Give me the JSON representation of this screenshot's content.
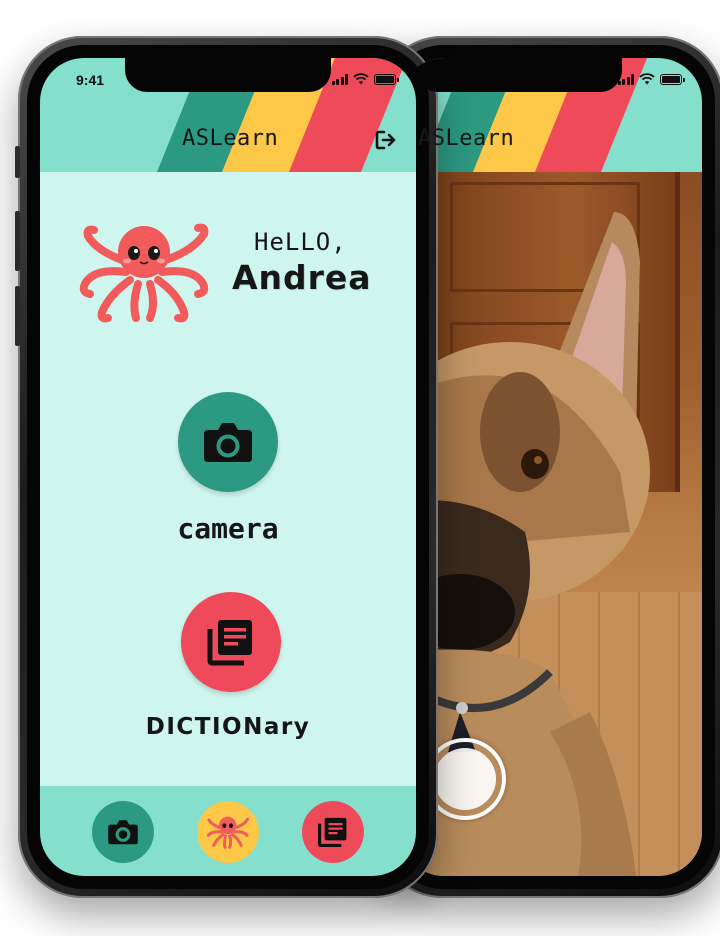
{
  "status_bar": {
    "time": "9:41"
  },
  "app": {
    "title": "ASLearn"
  },
  "greeting": {
    "line1": "HeLLO,",
    "name": "Andrea"
  },
  "actions": {
    "camera_label": "camera",
    "dictionary_label": "DICTIONary"
  },
  "bottom_nav": {
    "items": [
      {
        "id": "camera",
        "icon": "camera-icon"
      },
      {
        "id": "home",
        "icon": "octopus-icon"
      },
      {
        "id": "dictionary",
        "icon": "dictionary-icon"
      }
    ]
  },
  "colors": {
    "header_teal": "#85dfcd",
    "body_mint": "#cff6ee",
    "stripe_green": "#2c9a83",
    "stripe_yellow": "#fdc747",
    "stripe_red": "#ef4a5a",
    "octopus": "#f15b5b"
  },
  "icons": {
    "logout": "logout-icon",
    "camera": "camera-icon",
    "dictionary": "dictionary-icon",
    "mascot": "octopus-icon",
    "shutter": "shutter-button-icon"
  }
}
